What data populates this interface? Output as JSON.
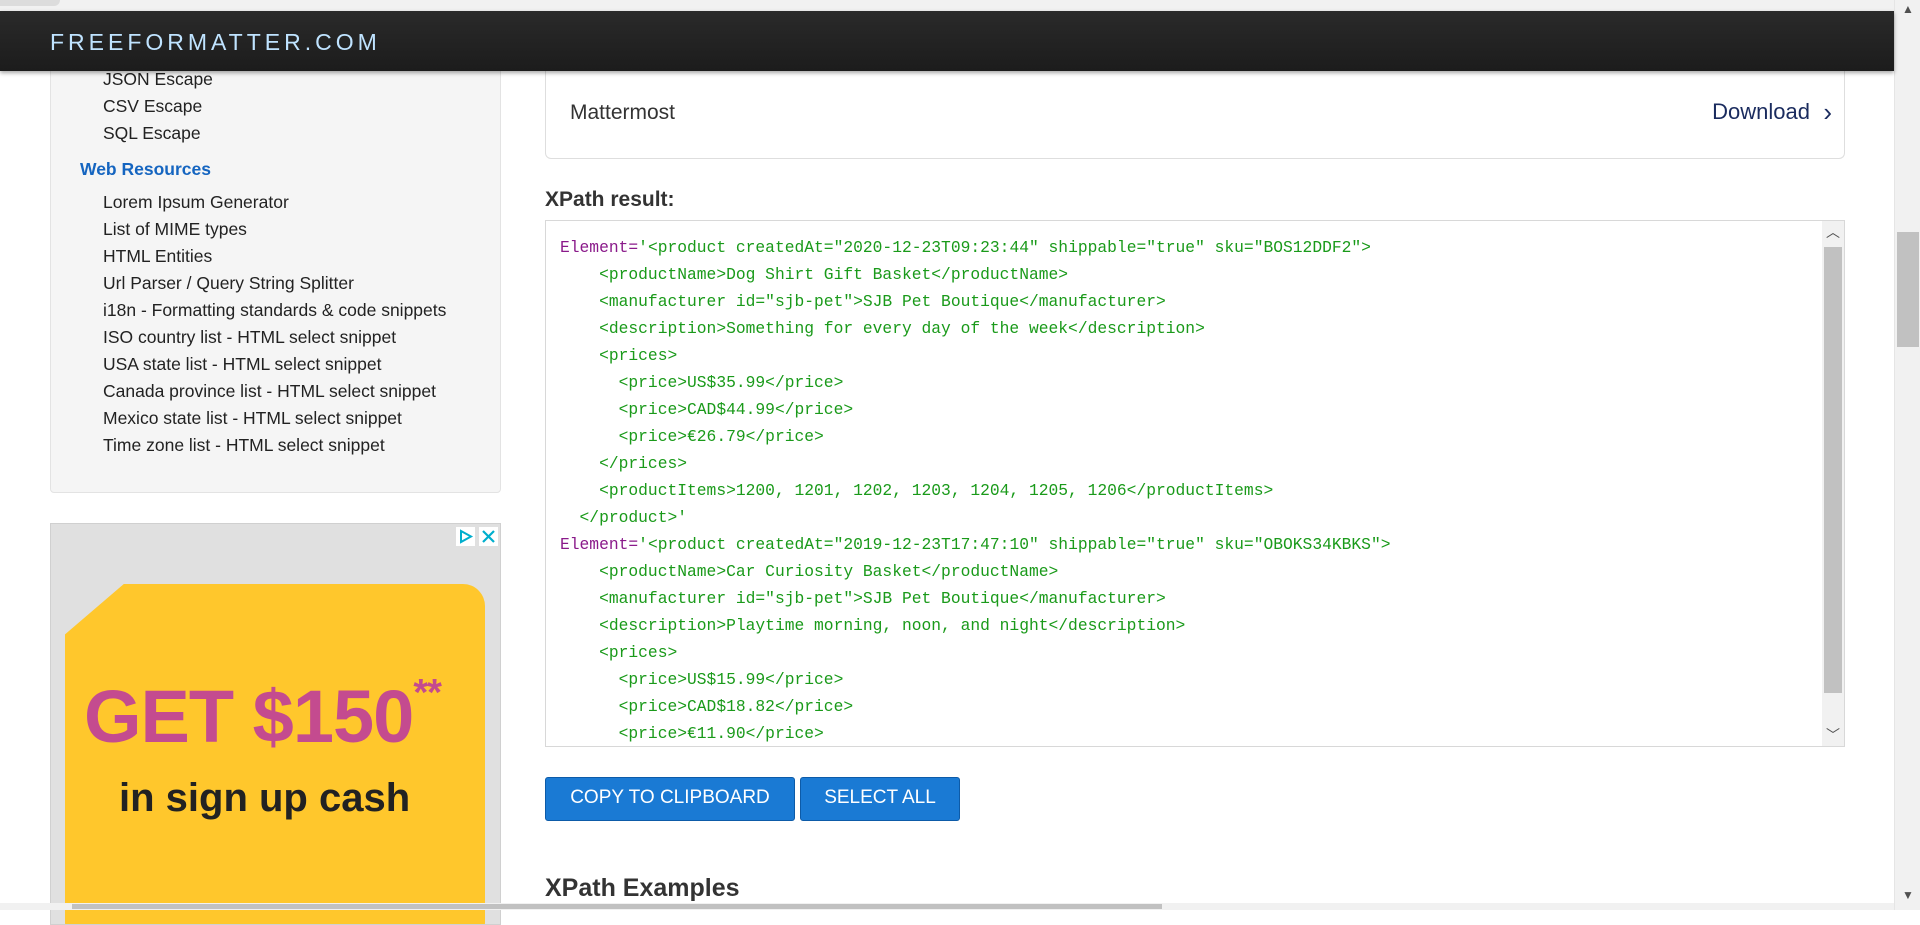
{
  "brand": "FREEFORMATTER.COM",
  "sidebar": {
    "links_top": [
      "JSON Escape",
      "CSV Escape",
      "SQL Escape"
    ],
    "section_heading": "Web Resources",
    "links_web": [
      "Lorem Ipsum Generator",
      "List of MIME types",
      "HTML Entities",
      "Url Parser / Query String Splitter",
      "i18n - Formatting standards & code snippets",
      "ISO country list - HTML select snippet",
      "USA state list - HTML select snippet",
      "Canada province list - HTML select snippet",
      "Mexico state list - HTML select snippet",
      "Time zone list - HTML select snippet"
    ]
  },
  "ad": {
    "headline": "GET $150",
    "headline_suffix": "**",
    "subline": "in sign up cash",
    "play_icon": "adchoices-icon",
    "close_icon": "close-icon"
  },
  "download_card": {
    "name": "Mattermost",
    "link": "Download",
    "chevron": "›"
  },
  "result": {
    "title": "XPath result:",
    "lines": [
      {
        "prefix": "Element=",
        "text": "'<product createdAt=\"2020-12-23T09:23:44\" shippable=\"true\" sku=\"BOS12DDF2\">"
      },
      {
        "prefix": "",
        "text": "    <productName>Dog Shirt Gift Basket</productName>"
      },
      {
        "prefix": "",
        "text": "    <manufacturer id=\"sjb-pet\">SJB Pet Boutique</manufacturer>"
      },
      {
        "prefix": "",
        "text": "    <description>Something for every day of the week</description>"
      },
      {
        "prefix": "",
        "text": "    <prices>"
      },
      {
        "prefix": "",
        "text": "      <price>US$35.99</price>"
      },
      {
        "prefix": "",
        "text": "      <price>CAD$44.99</price>"
      },
      {
        "prefix": "",
        "text": "      <price>€26.79</price>"
      },
      {
        "prefix": "",
        "text": "    </prices>"
      },
      {
        "prefix": "",
        "text": "    <productItems>1200, 1201, 1202, 1203, 1204, 1205, 1206</productItems>"
      },
      {
        "prefix": "",
        "text": "  </product>'"
      },
      {
        "prefix": "Element=",
        "text": "'<product createdAt=\"2019-12-23T17:47:10\" shippable=\"true\" sku=\"OBOKS34KBKS\">"
      },
      {
        "prefix": "",
        "text": "    <productName>Car Curiosity Basket</productName>"
      },
      {
        "prefix": "",
        "text": "    <manufacturer id=\"sjb-pet\">SJB Pet Boutique</manufacturer>"
      },
      {
        "prefix": "",
        "text": "    <description>Playtime morning, noon, and night</description>"
      },
      {
        "prefix": "",
        "text": "    <prices>"
      },
      {
        "prefix": "",
        "text": "      <price>US$15.99</price>"
      },
      {
        "prefix": "",
        "text": "      <price>CAD$18.82</price>"
      },
      {
        "prefix": "",
        "text": "      <price>€11.90</price>"
      }
    ]
  },
  "buttons": {
    "copy": "COPY TO CLIPBOARD",
    "select_all": "SELECT ALL"
  },
  "examples_title": "XPath Examples",
  "colors": {
    "navbar": "#1f1f1f",
    "brand": "#bfe3ff",
    "accent_button": "#1a7ad4",
    "code_green": "#1a9a1a",
    "code_purple": "#8a1a8a",
    "sidebar_heading": "#1565c0",
    "ad_yellow": "#ffc72c",
    "ad_pink": "#c44b8f"
  }
}
